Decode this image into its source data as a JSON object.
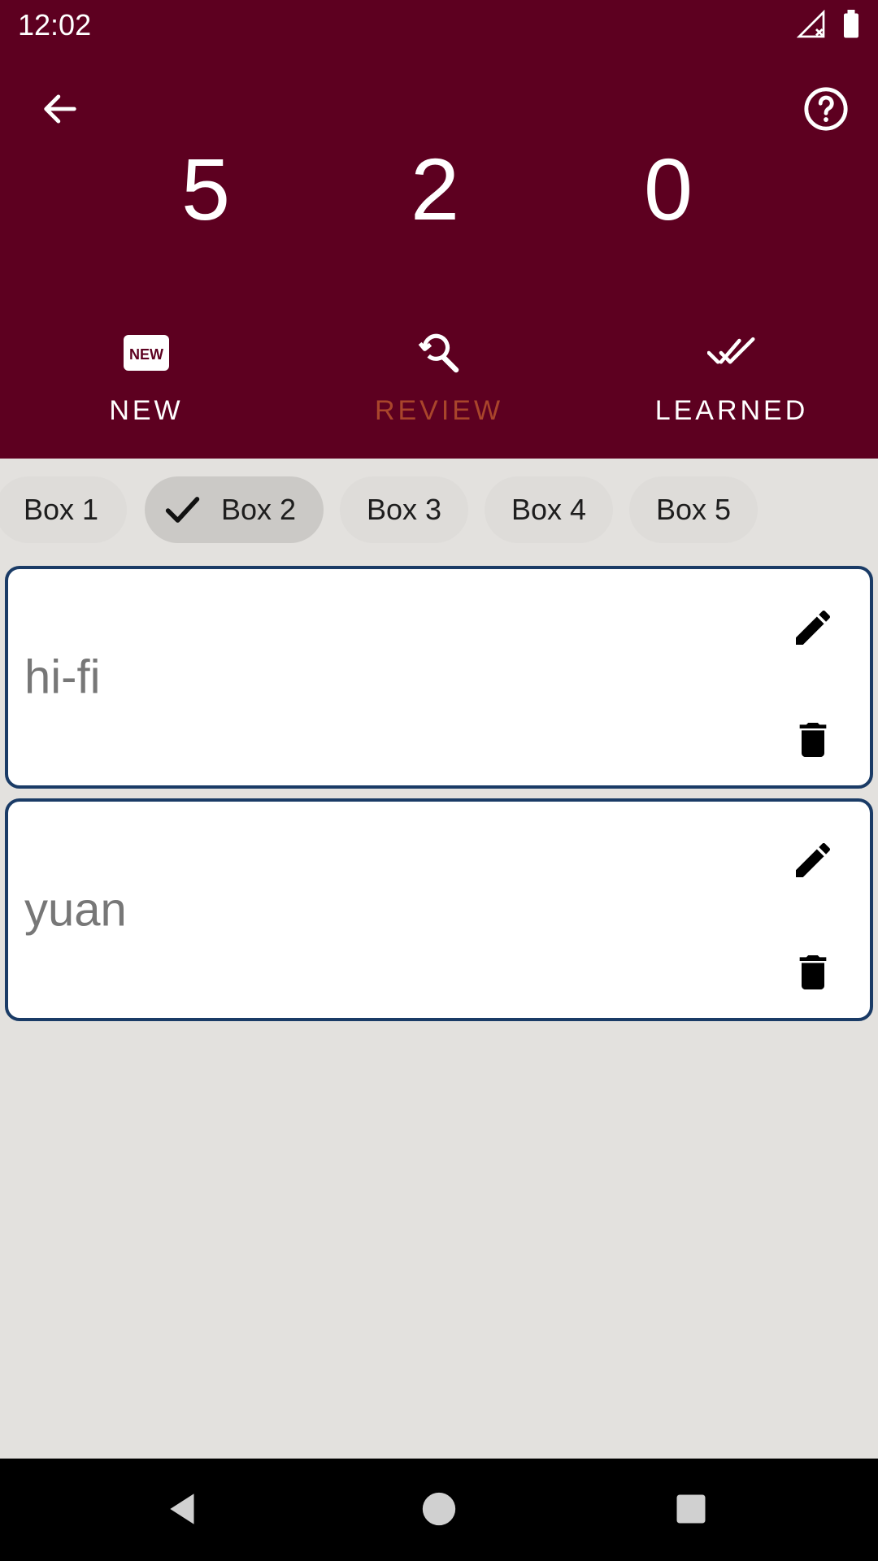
{
  "status_bar": {
    "time": "12:02",
    "icons": [
      "signal-off-icon",
      "battery-icon"
    ]
  },
  "header": {
    "back_icon": "arrow-back-icon",
    "help_icon": "help-circle-icon",
    "counts": {
      "new": "5",
      "review": "2",
      "learned": "0"
    }
  },
  "tabs": [
    {
      "label": "NEW",
      "icon": "new-badge-icon",
      "active": false
    },
    {
      "label": "REVIEW",
      "icon": "search-refresh-icon",
      "active": true
    },
    {
      "label": "LEARNED",
      "icon": "double-check-icon",
      "active": false
    }
  ],
  "chips": [
    {
      "label": "Box 1",
      "selected": false
    },
    {
      "label": "Box 2",
      "selected": true
    },
    {
      "label": "Box 3",
      "selected": false
    },
    {
      "label": "Box 4",
      "selected": false
    },
    {
      "label": "Box 5",
      "selected": false
    }
  ],
  "cards": [
    {
      "word": "hi-fi",
      "edit_icon": "pencil-icon",
      "delete_icon": "trash-icon"
    },
    {
      "word": "yuan",
      "edit_icon": "pencil-icon",
      "delete_icon": "trash-icon"
    }
  ],
  "nav_bar": {
    "icons": [
      "nav-back-icon",
      "nav-home-icon",
      "nav-recents-icon"
    ]
  },
  "colors": {
    "primary": "#5d0020",
    "active_tab": "#a9452b",
    "card_border": "#1a3b66",
    "background": "#e3e1de"
  }
}
